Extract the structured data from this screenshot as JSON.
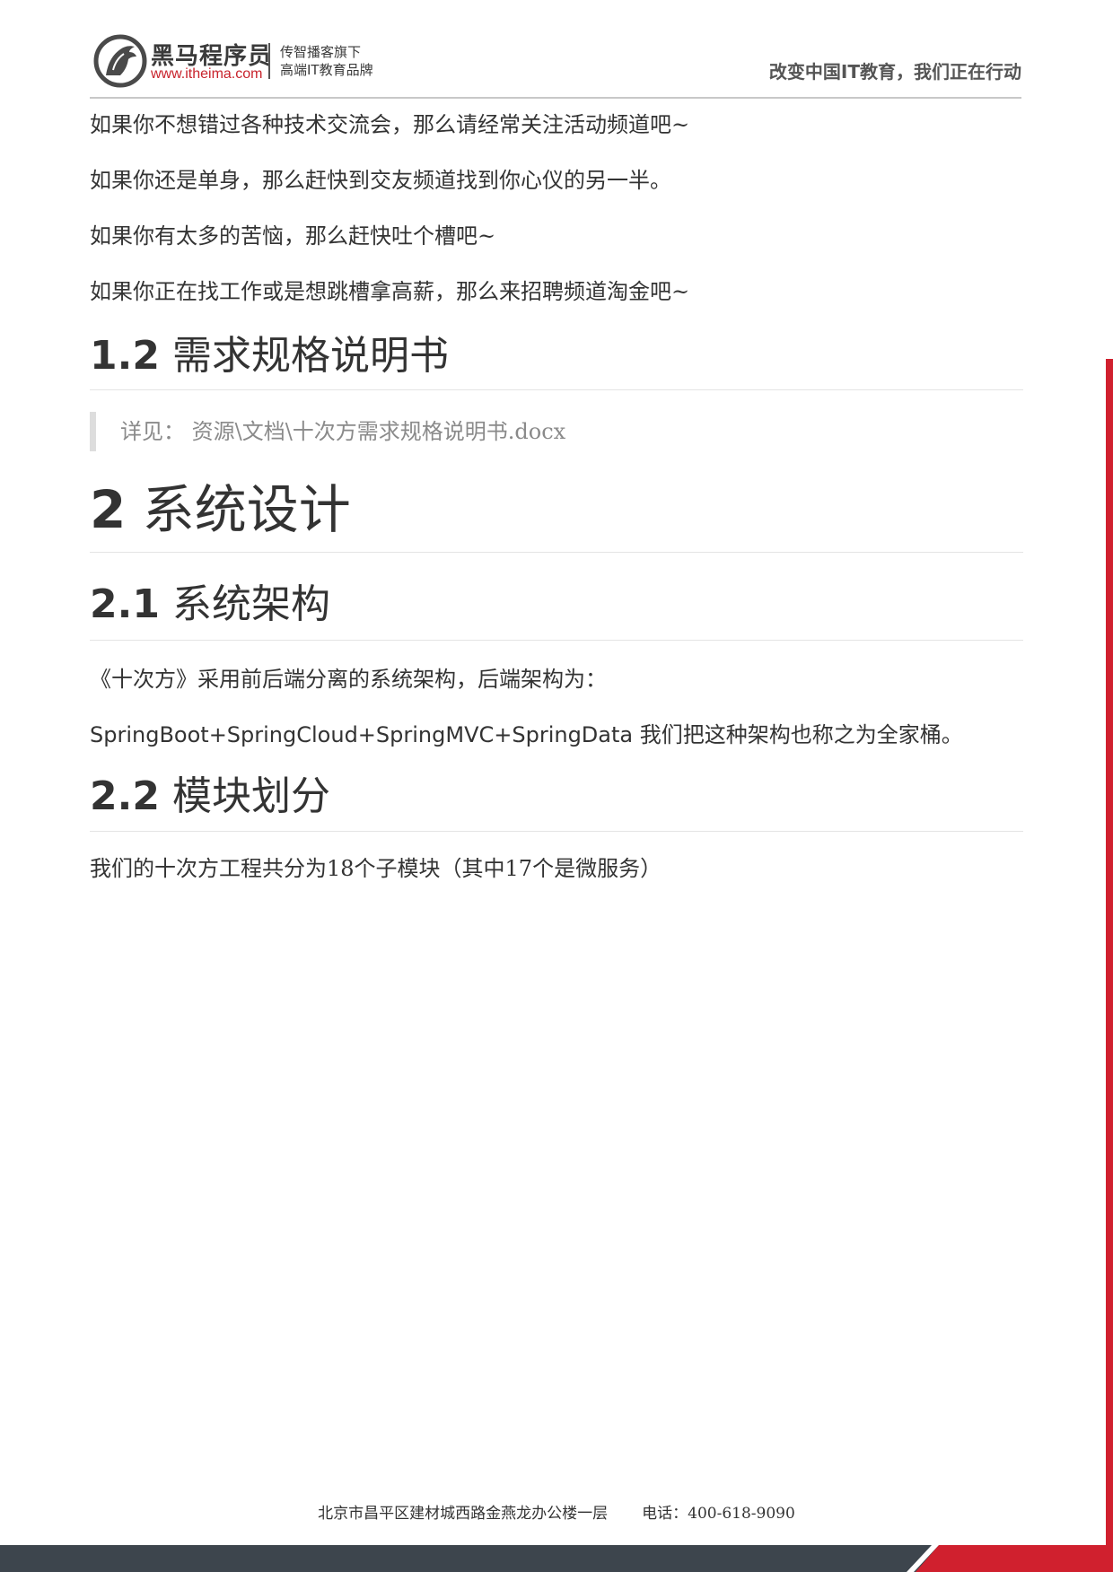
{
  "header": {
    "brand_name": "黑马程序员",
    "brand_url": "www.itheima.com",
    "slogan_line1": "传智播客旗下",
    "slogan_line2": "高端IT教育品牌",
    "tagline": "改变中国IT教育，我们正在行动"
  },
  "content": {
    "intro_paragraphs": [
      "如果你不想错过各种技术交流会，那么请经常关注活动频道吧~",
      "如果你还是单身，那么赶快到交友频道找到你心仪的另一半。",
      "如果你有太多的苦恼，那么赶快吐个槽吧~",
      "如果你正在找工作或是想跳槽拿高薪，那么来招聘频道淘金吧~"
    ],
    "section_1_2": {
      "number": "1.2",
      "title": "需求规格说明书",
      "quote": "详见： 资源\\文档\\十次方需求规格说明书.docx"
    },
    "section_2": {
      "number": "2",
      "title": "系统设计"
    },
    "section_2_1": {
      "number": "2.1",
      "title": "系统架构",
      "para1": "《十次方》采用前后端分离的系统架构，后端架构为：",
      "para2_latin": "SpringBoot+SpringCloud+SpringMVC+SpringData",
      "para2_cn": " 我们把这种架构也称之为全家桶。"
    },
    "section_2_2": {
      "number": "2.2",
      "title": "模块划分",
      "para1": "我们的十次方工程共分为18个子模块（其中17个是微服务）"
    }
  },
  "footer": {
    "address": "北京市昌平区建材城西路金燕龙办公楼一层",
    "phone": "电话：400-618-9090"
  },
  "colors": {
    "brand_red": "#d0202e",
    "footer_dark": "#3d454d",
    "text": "#333333",
    "quote_text": "#8a8a8a"
  }
}
